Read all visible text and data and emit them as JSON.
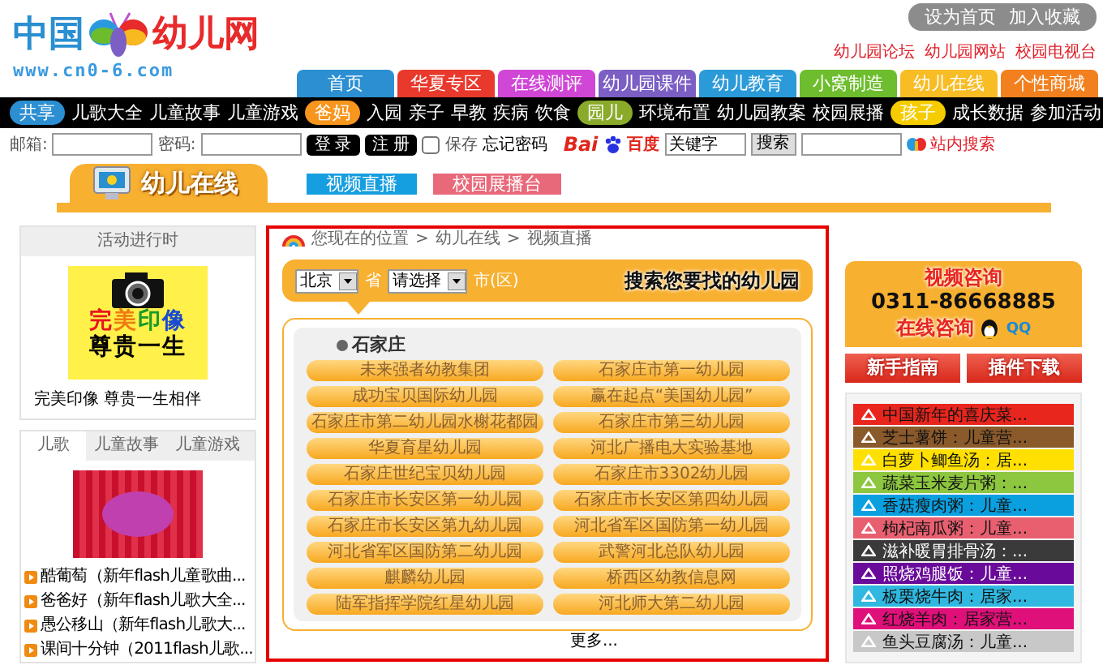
{
  "header": {
    "top_links": [
      "设为首页",
      "加入收藏"
    ],
    "logo": {
      "left": "中国",
      "right": "幼儿网",
      "url": "www.cn0-6.com"
    },
    "red_links": [
      "幼儿园论坛",
      "幼儿园网站",
      "校园电视台"
    ],
    "nav_tabs": [
      {
        "label": "首页",
        "color": "#2b8fd2"
      },
      {
        "label": "华夏专区",
        "color": "#e8392c"
      },
      {
        "label": "在线测评",
        "color": "#d046d6"
      },
      {
        "label": "幼儿园课件",
        "color": "#7b5fc4"
      },
      {
        "label": "幼儿教育",
        "color": "#2b9ad8"
      },
      {
        "label": "小窝制造",
        "color": "#6dbd2e"
      },
      {
        "label": "幼儿在线",
        "color": "#f8bc24"
      },
      {
        "label": "个性商城",
        "color": "#f2801e"
      }
    ]
  },
  "category_bar": [
    {
      "tag": "共享",
      "color": "#2b8fd2",
      "links": [
        "儿歌大全",
        "儿童故事",
        "儿童游戏"
      ]
    },
    {
      "tag": "爸妈",
      "color": "#f7951d",
      "links": [
        "入园",
        "亲子",
        "早教",
        "疾病",
        "饮食"
      ]
    },
    {
      "tag": "园儿",
      "color": "#8aab2a",
      "links": [
        "环境布置",
        "幼儿园教案",
        "校园展播"
      ]
    },
    {
      "tag": "孩子",
      "color": "#f5cc00",
      "links": [
        "成长数据",
        "参加活动"
      ]
    }
  ],
  "login": {
    "email_label": "邮箱:",
    "password_label": "密码:",
    "buttons": [
      "登 录",
      "注 册"
    ],
    "remember": {
      "label": "保存",
      "checked": false
    },
    "forgot": "忘记密码",
    "baidu": {
      "logo_left": "Bai",
      "logo_right": "百度",
      "value": "关键字",
      "button": "搜索"
    },
    "site_search": "站内搜索"
  },
  "section": {
    "title": "幼儿在线",
    "tabs": [
      {
        "label": "视频直播",
        "color": "#159ee0"
      },
      {
        "label": "校园展播台",
        "color": "#e8697a"
      }
    ]
  },
  "activity": {
    "title": "活动进行时",
    "banner": [
      "完美印像",
      "尊贵一生"
    ],
    "caption": "完美印像  尊贵一生相伴"
  },
  "media": {
    "tabs": [
      {
        "label": "儿歌",
        "selected": true
      },
      {
        "label": "儿童故事",
        "selected": false
      },
      {
        "label": "儿童游戏",
        "selected": false
      }
    ],
    "items": [
      "酷葡萄（新年flash儿童歌曲...",
      "爸爸好（新年flash儿歌大全...",
      "愚公移山（新年flash儿歌大...",
      "课间十分钟（2011flash儿歌..."
    ]
  },
  "breadcrumb": {
    "label": "您现在的位置",
    "separator": ">",
    "path": [
      "幼儿在线",
      "视频直播"
    ]
  },
  "finder": {
    "province": "北京",
    "province_unit": "省",
    "city": "请选择",
    "city_unit": "市(区)",
    "slogan": "搜索您要找的幼儿园"
  },
  "kindergartens": {
    "city": "石家庄",
    "items": [
      "未来强者幼教集团",
      "石家庄市第一幼儿园",
      "成功宝贝国际幼儿园",
      "赢在起点“美国幼儿园”",
      "石家庄市第二幼儿园水榭花都园",
      "石家庄市第三幼儿园",
      "华夏育星幼儿园",
      "河北广播电大实验基地",
      "石家庄世纪宝贝幼儿园",
      "石家庄市3302幼儿园",
      "石家庄市长安区第一幼儿园",
      "石家庄市长安区第四幼儿园",
      "石家庄市长安区第九幼儿园",
      "河北省军区国防第一幼儿园",
      "河北省军区国防第二幼儿园",
      "武警河北总队幼儿园",
      "麒麟幼儿园",
      "桥西区幼教信息网",
      "陆军指挥学院红星幼儿园",
      "河北师大第二幼儿园"
    ],
    "more": "更多..."
  },
  "consult": {
    "title": "视频咨询",
    "phone": "0311-86668885",
    "online": "在线咨询",
    "qq": "QQ"
  },
  "guide_buttons": [
    "新手指南",
    "插件下载"
  ],
  "recipes": [
    {
      "label": "中国新年的喜庆菜...",
      "color": "#e8261e"
    },
    {
      "label": "芝士薯饼：儿童营...",
      "color": "#8b5a2b"
    },
    {
      "label": "白萝卜鲫鱼汤：居...",
      "color": "#ffe000"
    },
    {
      "label": "蔬菜玉米麦片粥：...",
      "color": "#8dc63f"
    },
    {
      "label": "香菇瘦肉粥：儿童...",
      "color": "#0aa0e0"
    },
    {
      "label": "枸杞南瓜粥：儿童...",
      "color": "#e86070"
    },
    {
      "label": "滋补暖胃排骨汤：...",
      "color": "#3a3a3a"
    },
    {
      "label": "照烧鸡腿饭：儿童...",
      "color": "#6a0a9a"
    },
    {
      "label": "板栗烧牛肉：居家...",
      "color": "#30b8e0"
    },
    {
      "label": "红烧羊肉：居家营...",
      "color": "#e0107a"
    },
    {
      "label": "鱼头豆腐汤：儿童...",
      "color": "#c8c8c8"
    }
  ]
}
